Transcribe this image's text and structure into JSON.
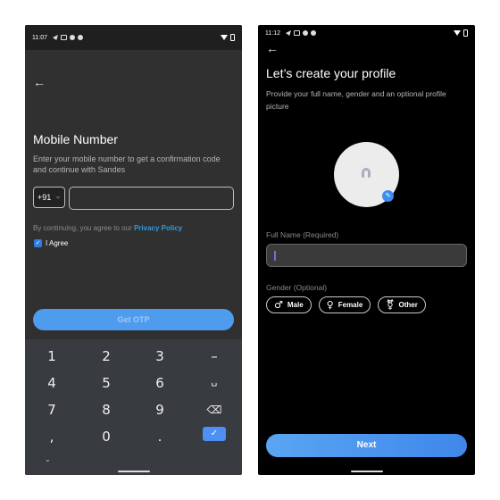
{
  "left_screen": {
    "status_bar": {
      "time": "11:07"
    },
    "title": "Mobile Number",
    "description": "Enter your mobile number to get a confirmation code and continue with Sandes",
    "country_code": "+91",
    "phone_input": {
      "value": "",
      "placeholder": ""
    },
    "consent_text": "By continuing, you agree to our ",
    "privacy_link": "Privacy Policy",
    "agree_label": "I Agree",
    "agree_checked": true,
    "get_otp_label": "Get OTP",
    "keypad": {
      "keys": [
        "1",
        "2",
        "3",
        "–",
        "4",
        "5",
        "6",
        "␣",
        "7",
        "8",
        "9",
        "⌫",
        ",",
        "0",
        "."
      ],
      "done_icon": "✓",
      "hide_icon": "⌄"
    }
  },
  "right_screen": {
    "status_bar": {
      "time": "11:12"
    },
    "title": "Let’s create your profile",
    "description": "Provide your full name, gender and an optional profile picture",
    "full_name_label": "Full Name (Required)",
    "full_name_input": {
      "value": "",
      "placeholder": ""
    },
    "gender_label": "Gender (Optional)",
    "gender_options": [
      {
        "label": "Male",
        "icon": "♂"
      },
      {
        "label": "Female",
        "icon": "♀"
      },
      {
        "label": "Other",
        "icon": "⚧"
      }
    ],
    "next_label": "Next"
  },
  "colors": {
    "accent": "#4f9cef",
    "link": "#2a9ce6"
  }
}
